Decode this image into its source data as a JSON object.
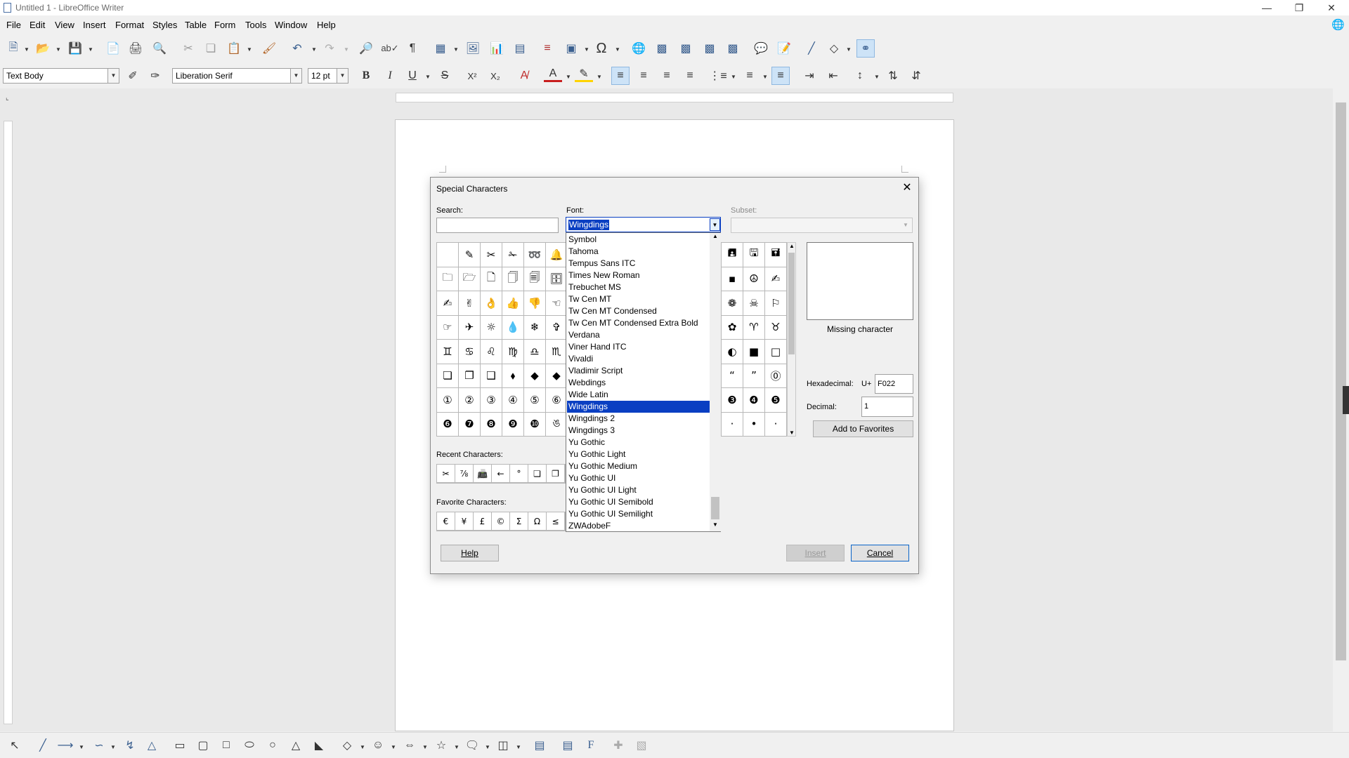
{
  "window": {
    "title": "Untitled 1 - LibreOffice Writer"
  },
  "menu": [
    "File",
    "Edit",
    "View",
    "Insert",
    "Format",
    "Styles",
    "Table",
    "Form",
    "Tools",
    "Window",
    "Help"
  ],
  "formatting": {
    "paragraph_style": "Text Body",
    "font_name": "Liberation Serif",
    "font_size": "12 pt"
  },
  "dialog": {
    "title": "Special Characters",
    "search_label": "Search:",
    "font_label": "Font:",
    "font_value": "Wingdings",
    "subset_label": "Subset:",
    "recent_label": "Recent Characters:",
    "favorites_label": "Favorite Characters:",
    "missing_label": "Missing character",
    "hex_label": "Hexadecimal:",
    "hex_prefix": "U+",
    "hex_value": "F022",
    "dec_label": "Decimal:",
    "dec_value": "1",
    "add_fav_button": "Add to Favorites",
    "help_button": "Help",
    "insert_button": "Insert",
    "cancel_button": "Cancel",
    "chars_left": [
      "",
      "✎",
      "✂",
      "✁",
      "➿",
      "🔔",
      "🗀",
      "🗁",
      "🗋",
      "🗍",
      "🗐",
      "🗄",
      "✍",
      "✌",
      "👌",
      "👍",
      "👎",
      "☜",
      "☞",
      "✈",
      "☼",
      "💧",
      "❄",
      "✞",
      "♊",
      "♋",
      "♌",
      "♍",
      "♎",
      "♏",
      "❏",
      "❐",
      "❑",
      "⬧",
      "◆",
      "◆",
      "①",
      "②",
      "③",
      "④",
      "⑤",
      "⑥",
      "❻",
      "❼",
      "❽",
      "❾",
      "❿",
      "ঙ"
    ],
    "chars_right": [
      "🖪",
      "🖫",
      "🖬",
      "▪",
      "☮",
      "✍",
      "❁",
      "☠",
      "⚐",
      "✿",
      "♈",
      "♉",
      "◐",
      "■",
      "□",
      "“",
      "”",
      "⓪",
      "❸",
      "❹",
      "❺",
      "·",
      "•",
      "·"
    ],
    "recent_chars": [
      "✂",
      "⅞",
      "📠",
      "←",
      "°",
      "❏",
      "❐"
    ],
    "favorite_chars": [
      "€",
      "¥",
      "£",
      "©",
      "Σ",
      "Ω",
      "≤"
    ],
    "font_list": [
      "Symbol",
      "Tahoma",
      "Tempus Sans ITC",
      "Times New Roman",
      "Trebuchet MS",
      "Tw Cen MT",
      "Tw Cen MT Condensed",
      "Tw Cen MT Condensed Extra Bold",
      "Verdana",
      "Viner Hand ITC",
      "Vivaldi",
      "Vladimir Script",
      "Webdings",
      "Wide Latin",
      "Wingdings",
      "Wingdings 2",
      "Wingdings 3",
      "Yu Gothic",
      "Yu Gothic Light",
      "Yu Gothic Medium",
      "Yu Gothic UI",
      "Yu Gothic UI Light",
      "Yu Gothic UI Semibold",
      "Yu Gothic UI Semilight",
      "ZWAdobeF"
    ],
    "font_selected": "Wingdings"
  }
}
